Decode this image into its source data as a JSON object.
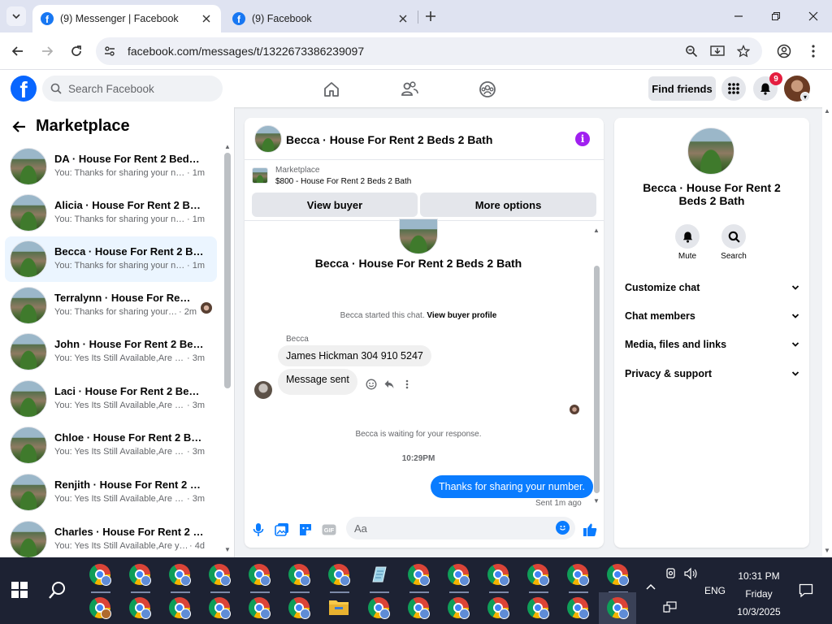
{
  "browser": {
    "tabs": [
      {
        "title": "(9) Messenger | Facebook",
        "active": true
      },
      {
        "title": "(9) Facebook",
        "active": false
      }
    ],
    "url": "facebook.com/messages/t/1322673386239097"
  },
  "fb_header": {
    "search_placeholder": "Search Facebook",
    "find_friends_label": "Find friends",
    "notification_count": "9"
  },
  "sidebar": {
    "title": "Marketplace",
    "conversations": [
      {
        "name": "DA · House For Rent 2 Beds 2 B...",
        "preview": "You: Thanks for sharing your num...",
        "time": " · 1m",
        "selected": false
      },
      {
        "name": "Alicia · House For Rent 2 Beds 2...",
        "preview": "You: Thanks for sharing your num...",
        "time": " · 1m",
        "selected": false
      },
      {
        "name": "Becca · House For Rent 2 Beds 2...",
        "preview": "You: Thanks for sharing your num...",
        "time": " · 1m",
        "selected": true
      },
      {
        "name": "Terralynn · House For Rent 2 ...",
        "preview": "You: Thanks for sharing your n...",
        "time": " · 2m",
        "selected": false
      },
      {
        "name": "John · House For Rent 2 Beds 2 ...",
        "preview": "You: Yes Its Still Available,Are you i...",
        "time": " · 3m",
        "selected": false
      },
      {
        "name": "Laci · House For Rent 2 Beds 2 ...",
        "preview": "You: Yes Its Still Available,Are you i...",
        "time": " · 3m",
        "selected": false
      },
      {
        "name": "Chloe · House For Rent 2 Beds 2...",
        "preview": "You: Yes Its Still Available,Are you i...",
        "time": " · 3m",
        "selected": false
      },
      {
        "name": "Renjith · House For Rent 2 Beds...",
        "preview": "You: Yes Its Still Available,Are you i...",
        "time": " · 3m",
        "selected": false
      },
      {
        "name": "Charles · House For Rent 2 Beds...",
        "preview": "You: Yes Its Still Available,Are you i...",
        "time": " · 4d",
        "selected": false
      }
    ]
  },
  "chat": {
    "title": "Becca · House For Rent 2 Beds 2 Bath",
    "marketplace_label": "Marketplace",
    "listing": "$800 - House For Rent 2 Beds 2 Bath",
    "view_buyer_label": "View buyer",
    "more_options_label": "More options",
    "thread_title": "Becca · House For Rent 2 Beds 2 Bath",
    "started_text": "Becca started this chat.",
    "view_buyer_profile": "View buyer profile",
    "sender_name": "Becca",
    "incoming_messages": [
      "James Hickman  304 910 5247",
      "Message sent"
    ],
    "waiting_text": "Becca is waiting for your response.",
    "timestamp": "10:29PM",
    "outgoing_message": "Thanks for sharing your number.",
    "sent_status": "Sent 1m ago",
    "composer_placeholder": "Aa"
  },
  "info_panel": {
    "name": "Becca · House For Rent 2 Beds 2 Bath",
    "actions": [
      {
        "label": "Mute",
        "icon": "bell-icon"
      },
      {
        "label": "Search",
        "icon": "search-icon"
      }
    ],
    "sections": [
      "Customize chat",
      "Chat members",
      "Media, files and links",
      "Privacy & support"
    ]
  },
  "taskbar": {
    "time": "10:31 PM",
    "day": "Friday",
    "date": "10/3/2025",
    "language": "ENG"
  },
  "colors": {
    "facebook_blue": "#0866ff",
    "outgoing_bubble": "#0a7cff",
    "notification_red": "#e41e3f",
    "selected_row": "#ebf5ff",
    "taskbar": "#1d2233"
  }
}
